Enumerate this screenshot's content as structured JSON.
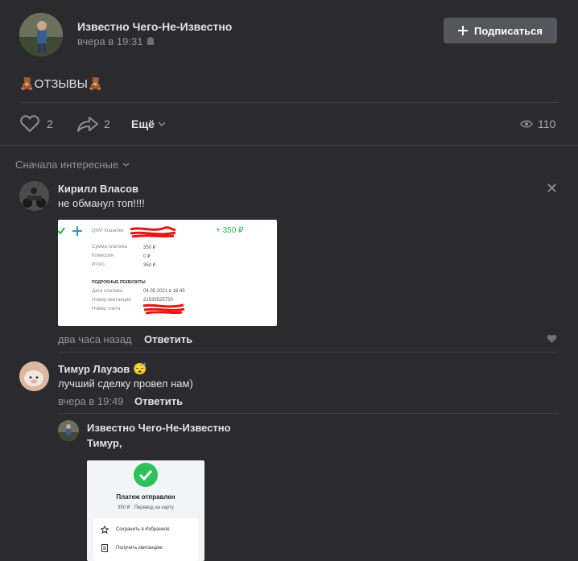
{
  "post": {
    "author": "Известно Чего-Не-Известно",
    "time": "вчера в 19:31",
    "subscribe_label": "Подписаться",
    "text": "🧸ОТЗЫВЫ🧸",
    "likes": "2",
    "shares": "2",
    "more_label": "Ещё",
    "views": "110"
  },
  "sort_label": "Сначала интересные",
  "comments": [
    {
      "author": "Кирилл Власов",
      "text": "не обманул топ!!!!",
      "time": "два часа назад",
      "reply_label": "Ответить",
      "receipt": {
        "amount": "+ 350 ₽",
        "wallet_label": "QIWI Кошелек",
        "rows": [
          {
            "k": "Сумма платежа",
            "v": "350 ₽"
          },
          {
            "k": "Комиссия",
            "v": "0 ₽"
          },
          {
            "k": "Итого",
            "v": "350 ₽"
          }
        ],
        "details_title": "ПОДРОБНЫЕ РЕКВИЗИТЫ",
        "details": [
          {
            "k": "Дата платежа",
            "v": "04.05.2021 в 16:45"
          },
          {
            "k": "Номер квитанции",
            "v": "21530525720"
          },
          {
            "k": "Номер счета",
            "v": ""
          }
        ]
      }
    },
    {
      "author": "Тимур Лаузов",
      "emoji": "😴",
      "text": "лучший сделку провел нам)",
      "time": "вчера в 19:49",
      "reply_label": "Ответить"
    }
  ],
  "reply": {
    "author": "Известно Чего-Не-Известно",
    "text": "Тимур,",
    "receipt": {
      "title": "Платеж отправлен",
      "sub": "350 ₽   Перевод на карту",
      "item1": "Сохранить в Избранное",
      "item2": "Получить квитанцию"
    }
  }
}
